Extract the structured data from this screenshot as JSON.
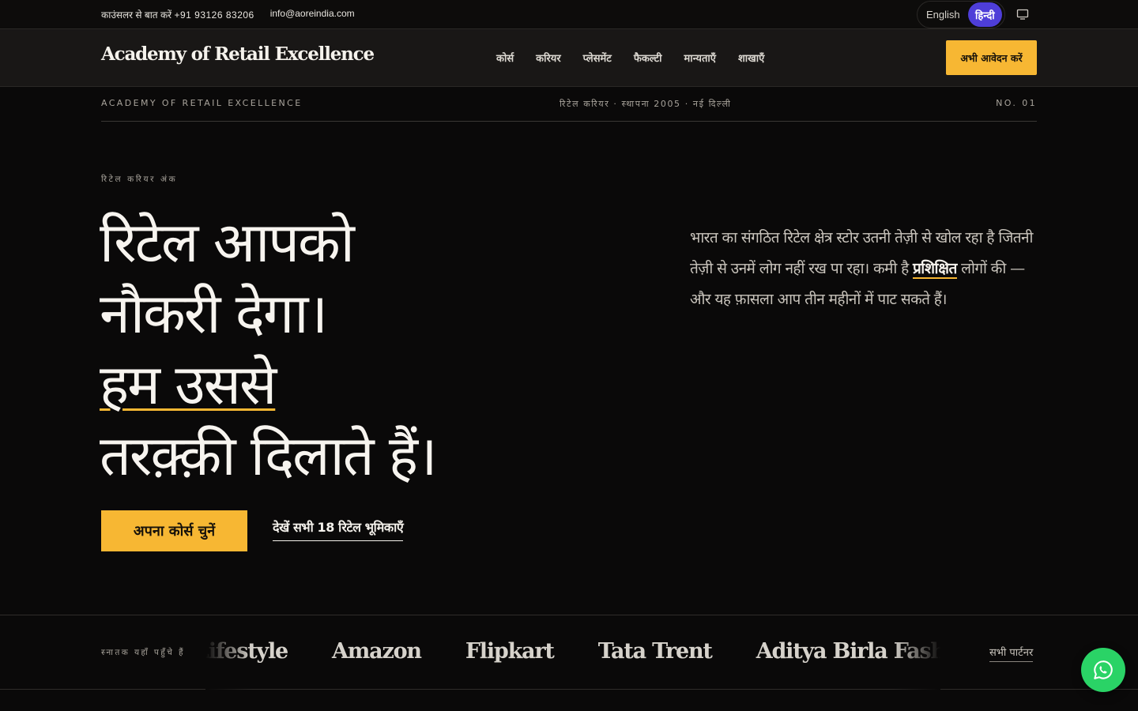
{
  "topbar": {
    "phone_label": "काउंसलर से बात करें",
    "phone_number": "+91  93126  83206",
    "email": "info@aoreindia.com",
    "lang_english": "English",
    "lang_hindi": "हिन्दी"
  },
  "nav": {
    "logo": "Academy of Retail Excellence",
    "links": [
      "कोर्स",
      "करियर",
      "प्लेसमेंट",
      "फैकल्टी",
      "मान्यताएँ",
      "शाखाएँ"
    ],
    "apply_label": "अभी आवेदन करें"
  },
  "masthead": {
    "left": "ACADEMY OF RETAIL EXCELLENCE",
    "center": "रिटेल करियर · स्थापना 2005 · नई दिल्ली",
    "right": "NO. 01"
  },
  "hero": {
    "eyebrow": "रिटेल करियर अंक",
    "title_line1": "रिटेल आपको",
    "title_line2": "नौकरी देगा।",
    "title_line3": "हम उससे",
    "title_line4": "तरक़्क़ी दिलाते हैं।",
    "desc_before": "भारत का संगठित रिटेल क्षेत्र स्टोर उतनी तेज़ी से खोल रहा है जितनी तेज़ी से उनमें लोग नहीं रख पा रहा। कमी है ",
    "desc_highlight": "प्रशिक्षित",
    "desc_after": " लोगों की — और यह फ़ासला आप तीन महीनों में पाट सकते हैं।",
    "cta_primary": "अपना कोर्स चुनें",
    "cta_secondary": "देखें सभी 18 रिटेल भूमिकाएँ"
  },
  "partners": {
    "label": "स्नातक यहाँ पहुँचे हैं",
    "names": [
      "Lifestyle",
      "Amazon",
      "Flipkart",
      "Tata Trent",
      "Aditya Birla Fashion"
    ],
    "all_label": "सभी पार्टनर"
  },
  "colors": {
    "accent": "#f7b733",
    "lang_active": "#4e3ed8",
    "whatsapp": "#2ad366",
    "background": "#0a0909"
  },
  "icons": {
    "screen": "monitor-icon",
    "whatsapp": "whatsapp-icon"
  }
}
